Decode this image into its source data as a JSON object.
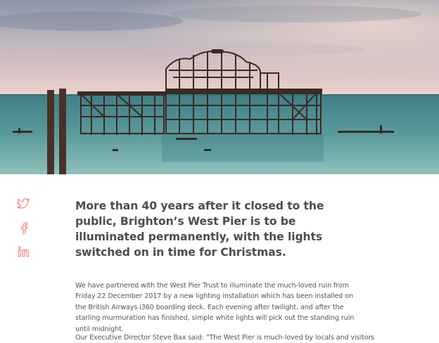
{
  "share": {
    "items": [
      {
        "icon": "twitter-icon",
        "color": "#f28b82"
      },
      {
        "icon": "facebook-icon",
        "color": "#f28b82"
      },
      {
        "icon": "linkedin-icon",
        "color": "#f28b82"
      }
    ]
  },
  "article": {
    "lead": "More than 40 years after it closed to the public, Brighton’s West Pier is to be illuminated permanently, with the lights switched on in time for Christmas.",
    "paragraph_1": "We have partnered with the West Pier Trust to illuminate the much-loved ruin from Friday 22 December 2017 by a new lighting installation which has been installed on the British Airways i360 boarding deck. Each evening after twilight, and after the starling murmuration has finished, simple white lights will pick out the standing ruin until midnight.",
    "paragraph_2": "Our Executive Director Steve Bax said: “The West Pier is much-loved by locals and visitors"
  },
  "colors": {
    "accent": "#f28b82",
    "heading": "#4d4d4d",
    "body": "#555555"
  }
}
